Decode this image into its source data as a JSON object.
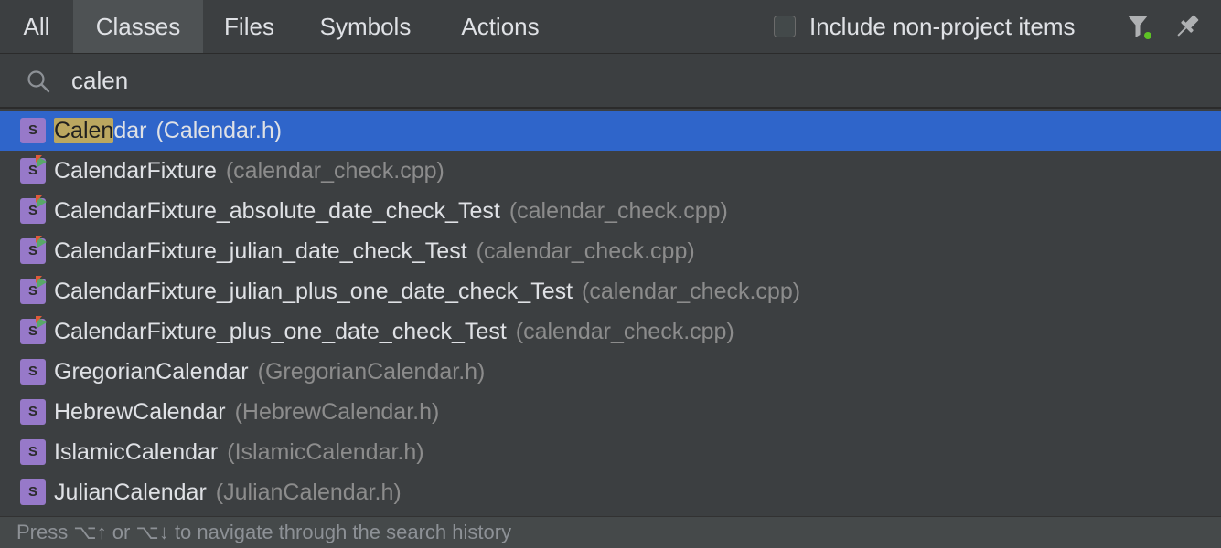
{
  "tabs": [
    {
      "label": "All",
      "active": false
    },
    {
      "label": "Classes",
      "active": true
    },
    {
      "label": "Files",
      "active": false
    },
    {
      "label": "Symbols",
      "active": false
    },
    {
      "label": "Actions",
      "active": false
    }
  ],
  "options": {
    "include_non_project_label": "Include non-project items",
    "include_non_project_checked": false
  },
  "toolbar_icons": [
    "filter-icon",
    "pin-icon"
  ],
  "search": {
    "icon": "search-icon",
    "query": "calen",
    "placeholder": ""
  },
  "results": [
    {
      "match": "Calen",
      "rest": "dar",
      "file": "(Calendar.h)",
      "icon": "class-icon",
      "selected": true
    },
    {
      "match": "",
      "rest": "CalendarFixture",
      "file": "(calendar_check.cpp)",
      "icon": "test-class-icon",
      "selected": false
    },
    {
      "match": "",
      "rest": "CalendarFixture_absolute_date_check_Test",
      "file": "(calendar_check.cpp)",
      "icon": "test-class-icon",
      "selected": false
    },
    {
      "match": "",
      "rest": "CalendarFixture_julian_date_check_Test",
      "file": "(calendar_check.cpp)",
      "icon": "test-class-icon",
      "selected": false
    },
    {
      "match": "",
      "rest": "CalendarFixture_julian_plus_one_date_check_Test",
      "file": "(calendar_check.cpp)",
      "icon": "test-class-icon",
      "selected": false
    },
    {
      "match": "",
      "rest": "CalendarFixture_plus_one_date_check_Test",
      "file": "(calendar_check.cpp)",
      "icon": "test-class-icon",
      "selected": false
    },
    {
      "match": "",
      "rest": "GregorianCalendar",
      "file": "(GregorianCalendar.h)",
      "icon": "class-icon",
      "selected": false
    },
    {
      "match": "",
      "rest": "HebrewCalendar",
      "file": "(HebrewCalendar.h)",
      "icon": "class-icon",
      "selected": false
    },
    {
      "match": "",
      "rest": "IslamicCalendar",
      "file": "(IslamicCalendar.h)",
      "icon": "class-icon",
      "selected": false
    },
    {
      "match": "",
      "rest": "JulianCalendar",
      "file": "(JulianCalendar.h)",
      "icon": "class-icon",
      "selected": false
    }
  ],
  "class_icon_letter": "S",
  "footer": {
    "hint": "Press ⌥↑ or ⌥↓ to navigate through the search history"
  },
  "colors": {
    "background": "#3c3f41",
    "active_tab": "#4e5254",
    "selection": "#2f65ca",
    "match_highlight": "#bba760",
    "class_icon": "#9779c9",
    "filter_indicator": "#5ec225"
  }
}
